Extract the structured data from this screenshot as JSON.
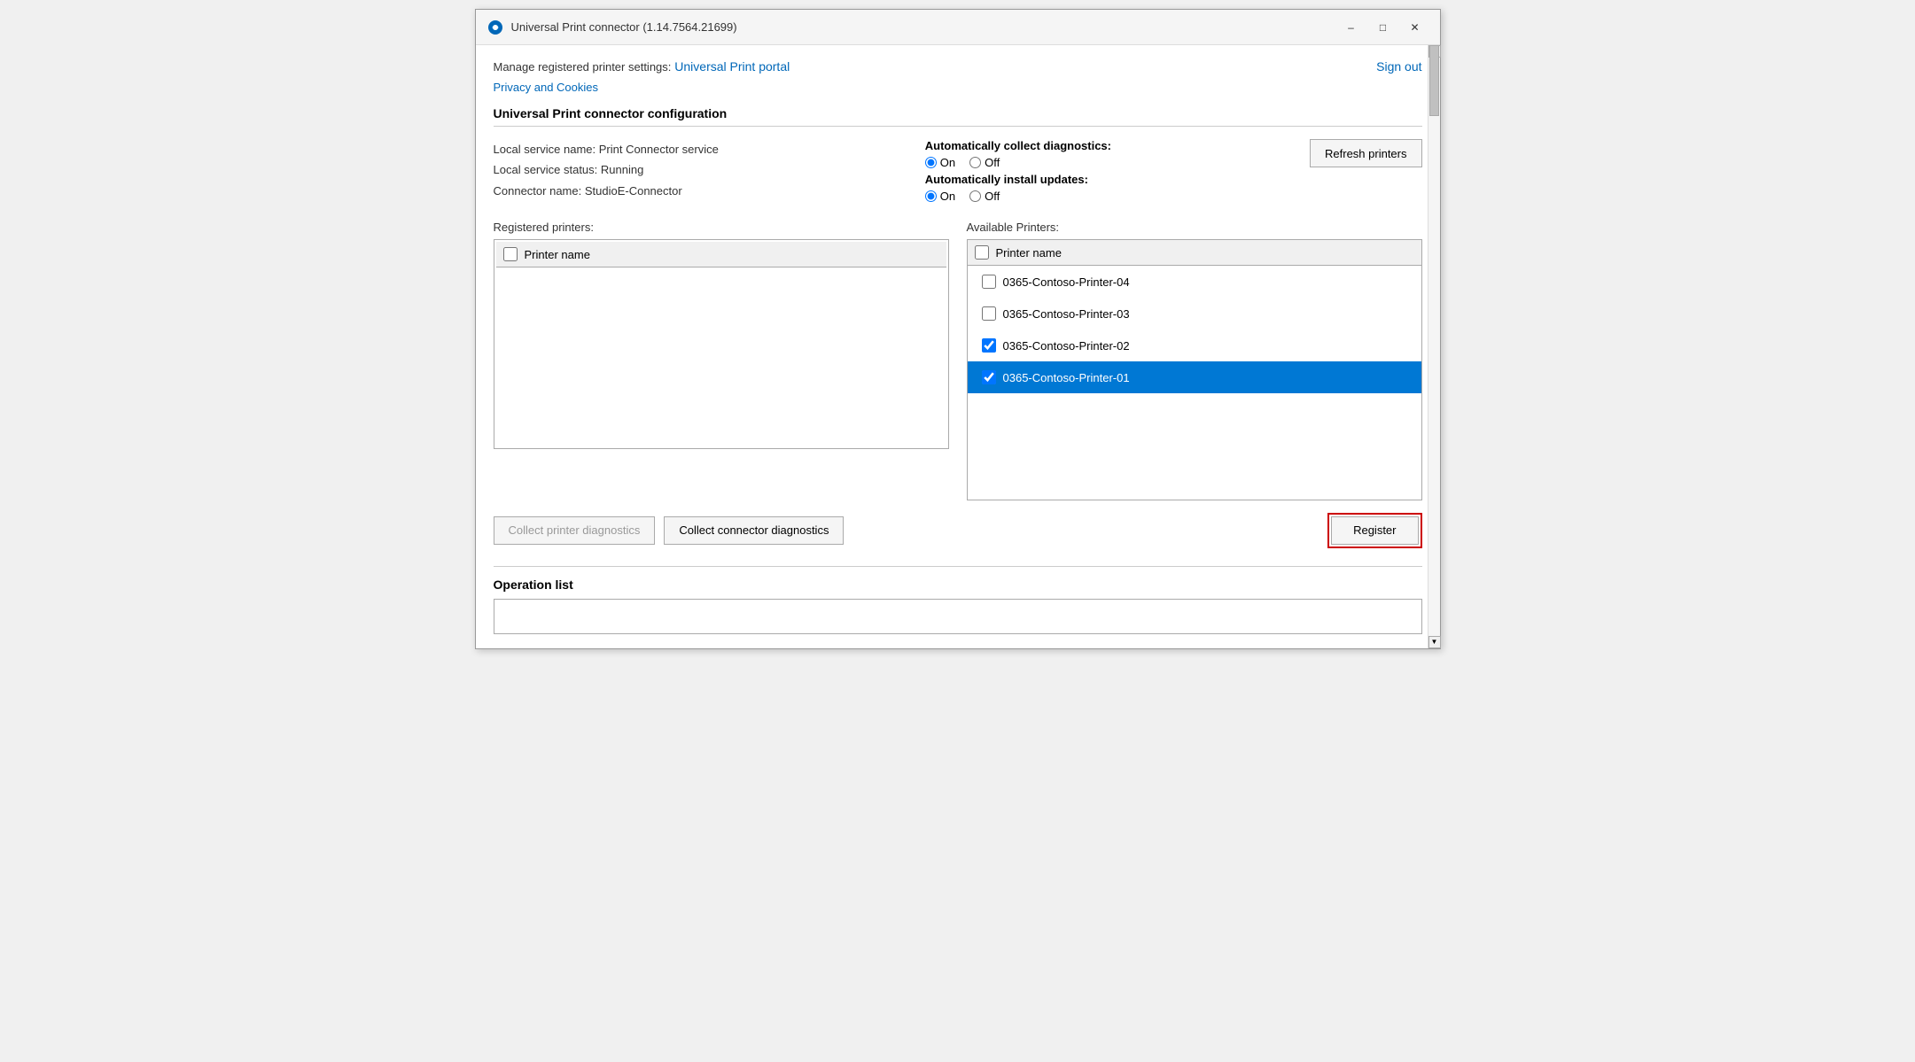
{
  "window": {
    "title": "Universal Print connector (1.14.7564.21699)",
    "minimize_label": "–",
    "maximize_label": "□",
    "close_label": "✕"
  },
  "header": {
    "manage_text": "Manage registered printer settings:",
    "portal_link": "Universal Print portal",
    "sign_out": "Sign out",
    "privacy_link": "Privacy and Cookies"
  },
  "config": {
    "section_title": "Universal Print connector configuration",
    "service_name": "Local service name: Print Connector service",
    "service_status": "Local service status: Running",
    "connector_name": "Connector name: StudioE-Connector"
  },
  "diagnostics": {
    "label": "Automatically collect diagnostics:",
    "on_label": "On",
    "off_label": "Off",
    "on_checked": true
  },
  "updates": {
    "label": "Automatically install updates:",
    "on_label": "On",
    "off_label": "Off",
    "on_checked": true
  },
  "refresh_btn": "Refresh printers",
  "registered_printers": {
    "label": "Registered printers:",
    "header": "Printer name",
    "items": []
  },
  "available_printers": {
    "label": "Available Printers:",
    "header": "Printer name",
    "items": [
      {
        "name": "0365-Contoso-Printer-04",
        "checked": false,
        "selected": false
      },
      {
        "name": "0365-Contoso-Printer-03",
        "checked": false,
        "selected": false
      },
      {
        "name": "0365-Contoso-Printer-02",
        "checked": true,
        "selected": false
      },
      {
        "name": "0365-Contoso-Printer-01",
        "checked": true,
        "selected": true
      }
    ]
  },
  "buttons": {
    "collect_printer": "Collect printer diagnostics",
    "collect_connector": "Collect connector diagnostics",
    "register": "Register"
  },
  "operation": {
    "title": "Operation list"
  }
}
